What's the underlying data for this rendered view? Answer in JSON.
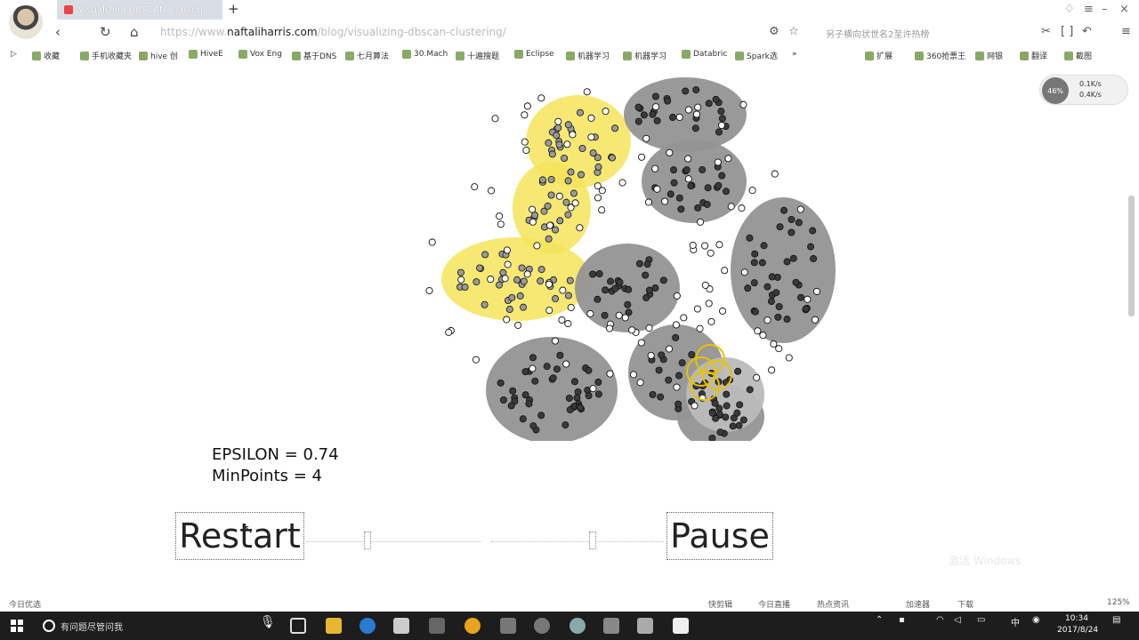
{
  "browser": {
    "tab_title": "Visualizing DBSCAN Clusteri",
    "new_tab": "+",
    "url_prefix": "https://www.",
    "url_domain": "naftaliharris.com",
    "url_path": "/blog/visualizing-dbscan-clustering/",
    "search_hint": "另子横向状世名2至许热榜"
  },
  "bookmarks": [
    "收藏",
    "手机收藏夹",
    "hive 创",
    "HiveE",
    "Vox Eng",
    "基于DNS",
    "七月算法",
    "30.Mach",
    "十遍搜题",
    "Eclipse",
    "机器学习",
    "机器学习",
    "Databric",
    "Spark选",
    "扩展",
    "360抢票王",
    "网银",
    "翻译",
    "截图"
  ],
  "net_widget": {
    "percent": "46%",
    "up": "0.1K/s",
    "down": "0.4K/s"
  },
  "params": {
    "epsilon_line": "EPSILON = 0.74",
    "minpoints_line": "MinPoints = 4"
  },
  "controls": {
    "restart": "Restart",
    "pause": "Pause"
  },
  "watermark": "激活 Windows",
  "statusbar": {
    "left": "今日优选",
    "items": [
      "快剪辑",
      "今日直播",
      "热点资讯",
      "加速器",
      "下载"
    ],
    "zoom": "125%"
  },
  "taskbar": {
    "search": "有问题尽管问我",
    "ime": "中",
    "time": "10:34",
    "date": "2017/8/24"
  },
  "colors": {
    "cluster_yellow": "#f5e45a",
    "cluster_gray": "#939393",
    "taskbar": "#1d1d1d"
  }
}
